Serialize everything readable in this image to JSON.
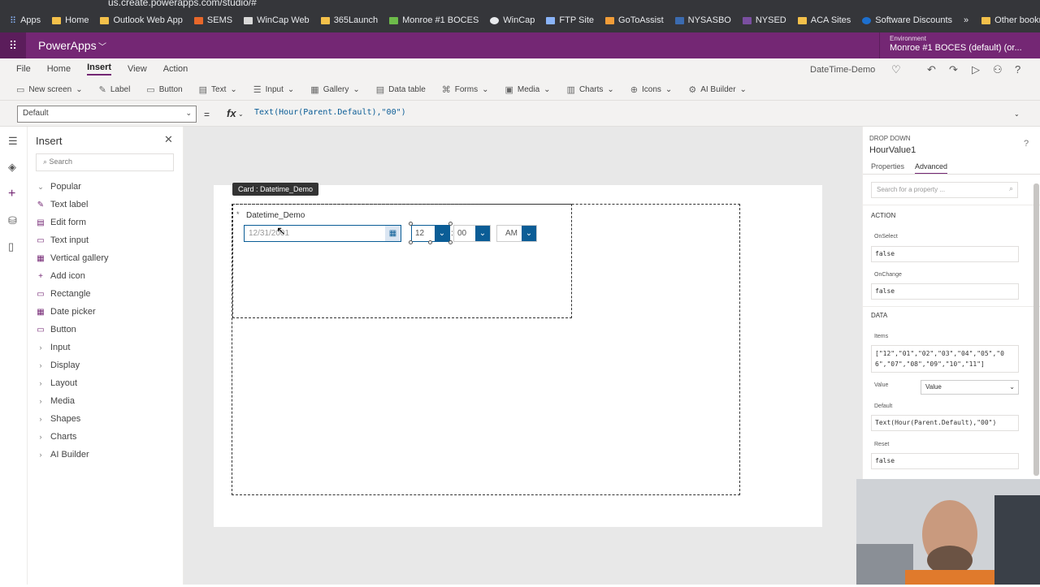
{
  "browser": {
    "url": "us.create.powerapps.com/studio/#",
    "bookmarks": [
      "Apps",
      "Home",
      "Outlook Web App",
      "SEMS",
      "WinCap Web",
      "365Launch",
      "Monroe #1 BOCES",
      "WinCap",
      "FTP Site",
      "GoToAssist",
      "NYSASBO",
      "NYSED",
      "ACA Sites",
      "Software Discounts"
    ],
    "more": "»",
    "other_bookmarks": "Other bookmarks"
  },
  "app": {
    "name": "PowerApps",
    "environment_label": "Environment",
    "environment_name": "Monroe #1 BOCES (default) (or..."
  },
  "menu": {
    "items": [
      "File",
      "Home",
      "Insert",
      "View",
      "Action"
    ],
    "active": "Insert",
    "document_title": "DateTime-Demo"
  },
  "toolbar": {
    "items": [
      {
        "icon": "new-screen-icon",
        "label": "New screen",
        "dropdown": true
      },
      {
        "icon": "label-icon",
        "label": "Label",
        "dropdown": false
      },
      {
        "icon": "button-icon",
        "label": "Button",
        "dropdown": false
      },
      {
        "icon": "text-icon",
        "label": "Text",
        "dropdown": true
      },
      {
        "icon": "input-icon",
        "label": "Input",
        "dropdown": true
      },
      {
        "icon": "gallery-icon",
        "label": "Gallery",
        "dropdown": true
      },
      {
        "icon": "data-table-icon",
        "label": "Data table",
        "dropdown": false
      },
      {
        "icon": "forms-icon",
        "label": "Forms",
        "dropdown": true
      },
      {
        "icon": "media-icon",
        "label": "Media",
        "dropdown": true
      },
      {
        "icon": "charts-icon",
        "label": "Charts",
        "dropdown": true
      },
      {
        "icon": "icons-icon",
        "label": "Icons",
        "dropdown": true
      },
      {
        "icon": "ai-builder-icon",
        "label": "AI Builder",
        "dropdown": true
      }
    ]
  },
  "formula_bar": {
    "property": "Default",
    "equals": "=",
    "fx": "fx",
    "formula": "Text(Hour(Parent.Default),\"00\")"
  },
  "insert_pane": {
    "title": "Insert",
    "search_placeholder": "Search",
    "popular_label": "Popular",
    "popular_items": [
      "Text label",
      "Edit form",
      "Text input",
      "Vertical gallery",
      "Add icon",
      "Rectangle",
      "Date picker",
      "Button"
    ],
    "categories": [
      "Input",
      "Display",
      "Layout",
      "Media",
      "Shapes",
      "Charts",
      "AI Builder"
    ]
  },
  "canvas": {
    "card_tag": "Card : Datetime_Demo",
    "required_mark": "*",
    "field_label": "Datetime_Demo",
    "date_value": "12/31/2001",
    "hour_value": "12",
    "colon": ":",
    "minute_value": "00",
    "ampm_value": "AM"
  },
  "properties_pane": {
    "control_type": "DROP DOWN",
    "control_name": "HourValue1",
    "tabs": [
      "Properties",
      "Advanced"
    ],
    "active_tab": "Advanced",
    "search_placeholder": "Search for a property ...",
    "action_section": "ACTION",
    "onselect_label": "OnSelect",
    "onselect_value": "false",
    "onchange_label": "OnChange",
    "onchange_value": "false",
    "data_section": "DATA",
    "items_label": "Items",
    "items_value": "[\"12\",\"01\",\"02\",\"03\",\"04\",\"05\",\"06\",\"07\",\"08\",\"09\",\"10\",\"11\"]",
    "value_label": "Value",
    "value_selected": "Value",
    "default_label": "Default",
    "default_value": "Text(Hour(Parent.Default),\"00\")",
    "reset_label": "Reset",
    "reset_value": "false"
  },
  "colors": {
    "app_header": "#742774",
    "accent_blue": "#0b5d96",
    "browser_bar": "#35363a"
  }
}
